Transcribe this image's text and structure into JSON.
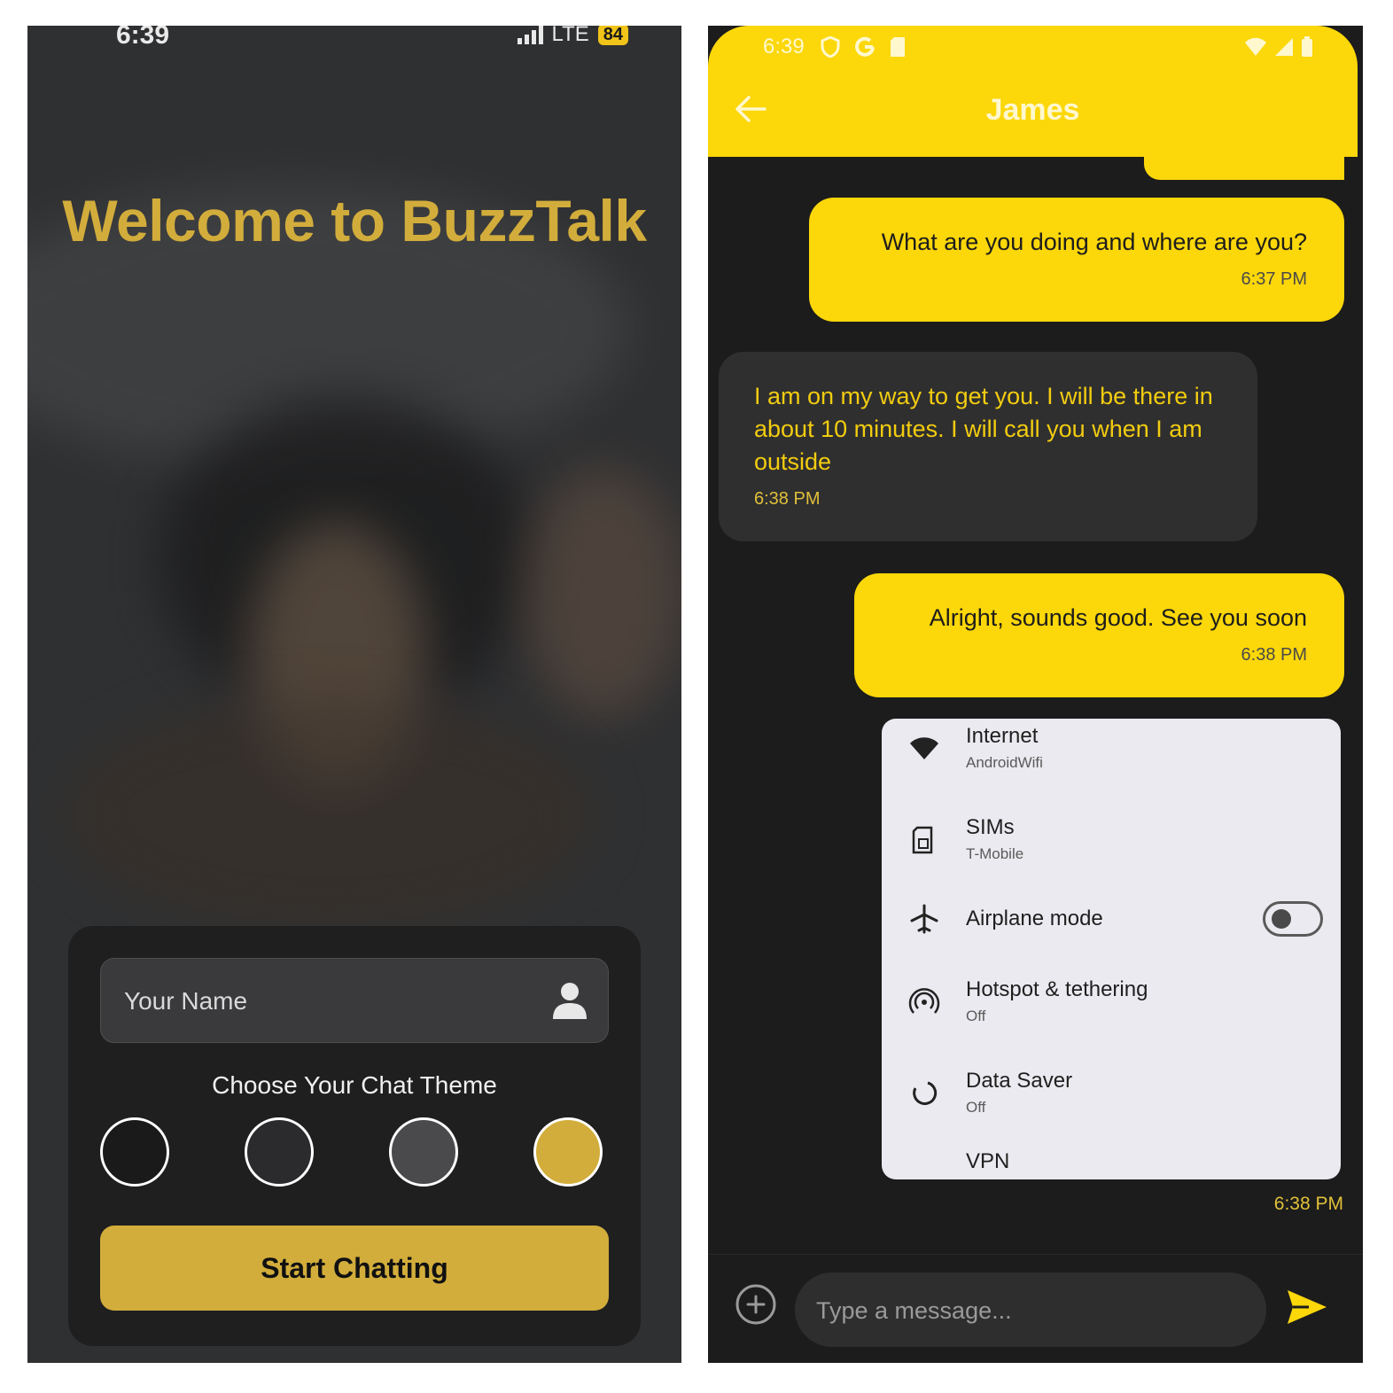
{
  "welcome_screen": {
    "status_bar": {
      "time": "6:39",
      "network": "LTE",
      "battery": "84"
    },
    "title": "Welcome to BuzzTalk",
    "name_input": {
      "placeholder": "Your Name",
      "value": ""
    },
    "theme_label": "Choose Your Chat Theme",
    "themes": [
      {
        "name": "black",
        "color": "#1a1a1a"
      },
      {
        "name": "dark-gray",
        "color": "#2b2b2d"
      },
      {
        "name": "gray",
        "color": "#4a4a4c"
      },
      {
        "name": "gold",
        "color": "#d2ad3b"
      }
    ],
    "start_button": "Start Chatting",
    "colors": {
      "accent": "#d2ad3b",
      "card": "#1f1f20"
    }
  },
  "chat_screen": {
    "status_bar": {
      "time": "6:39"
    },
    "contact_name": "James",
    "messages": [
      {
        "direction": "out",
        "text": "What are you doing and where are you?",
        "time": "6:37 PM"
      },
      {
        "direction": "in",
        "text": "I am on my way to get you. I will be there in about 10 minutes. I will call you when I am outside",
        "time": "6:38 PM"
      },
      {
        "direction": "out",
        "text": "Alright, sounds good. See you soon",
        "time": "6:38 PM"
      }
    ],
    "image_message": {
      "time": "6:38 PM",
      "settings": [
        {
          "icon": "wifi-icon",
          "title": "Internet",
          "subtitle": "AndroidWifi"
        },
        {
          "icon": "sim-card-icon",
          "title": "SIMs",
          "subtitle": "T-Mobile"
        },
        {
          "icon": "airplane-icon",
          "title": "Airplane mode",
          "subtitle": "",
          "toggle": false
        },
        {
          "icon": "hotspot-icon",
          "title": "Hotspot & tethering",
          "subtitle": "Off"
        },
        {
          "icon": "data-saver-icon",
          "title": "Data Saver",
          "subtitle": "Off"
        },
        {
          "icon": "vpn-icon",
          "title": "VPN",
          "subtitle": ""
        }
      ]
    },
    "composer": {
      "placeholder": "Type a message..."
    },
    "colors": {
      "accent": "#fcd709",
      "incoming_bubble": "#2f2f2f",
      "background": "#1c1c1c"
    }
  }
}
